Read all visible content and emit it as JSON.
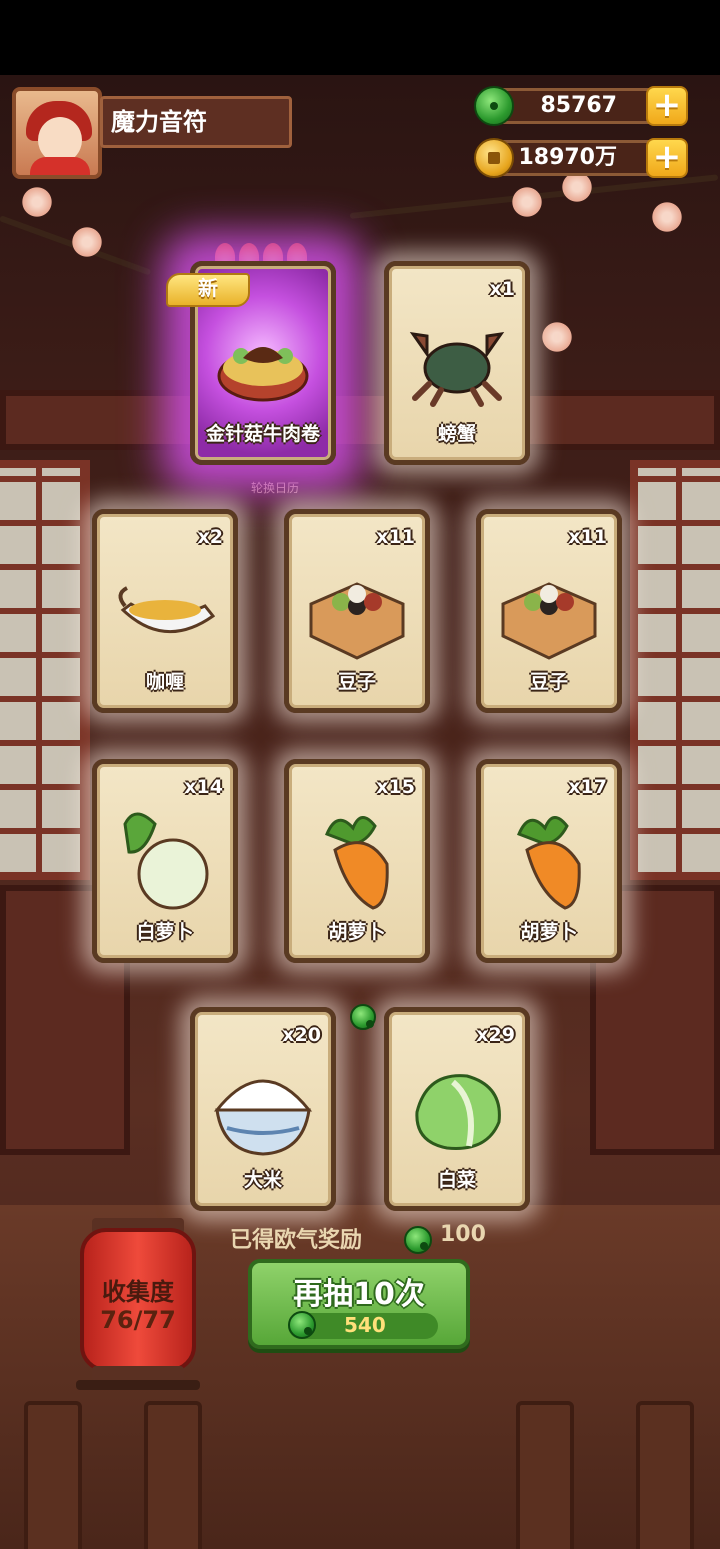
{
  "player": {
    "name": "魔力音符"
  },
  "currency": {
    "jade": {
      "icon": "jade-coin-icon",
      "amount": "85767"
    },
    "gold": {
      "icon": "gold-coin-icon",
      "amount": "18970万"
    },
    "plus": "+"
  },
  "cards": [
    {
      "name": "金针菇牛肉卷",
      "count": "",
      "is_new": true,
      "new_label": "新",
      "art": "beef-roll-icon"
    },
    {
      "name": "螃蟹",
      "count": "x1",
      "art": "crab-icon"
    },
    {
      "name": "咖喱",
      "count": "x2",
      "art": "curry-icon"
    },
    {
      "name": "豆子",
      "count": "x11",
      "art": "beans-icon"
    },
    {
      "name": "豆子",
      "count": "x11",
      "art": "beans-icon"
    },
    {
      "name": "白萝卜",
      "count": "x14",
      "art": "white-radish-icon"
    },
    {
      "name": "胡萝卜",
      "count": "x15",
      "art": "carrot-icon"
    },
    {
      "name": "胡萝卜",
      "count": "x17",
      "art": "carrot-icon"
    },
    {
      "name": "大米",
      "count": "x20",
      "art": "rice-icon"
    },
    {
      "name": "白菜",
      "count": "x29",
      "art": "cabbage-icon"
    }
  ],
  "background": {
    "calendar_label": "轮换日历"
  },
  "rewards": {
    "label": "已得欧气奖励",
    "value": "100"
  },
  "collection": {
    "label": "收集度",
    "progress": "76/77"
  },
  "draw_button": {
    "label": "再抽10次",
    "cost": "540"
  },
  "colors": {
    "accent_green": "#57a738",
    "gold": "#f0a81a",
    "card_bg": "#f3e6c6",
    "new_glow": "#c550df"
  }
}
